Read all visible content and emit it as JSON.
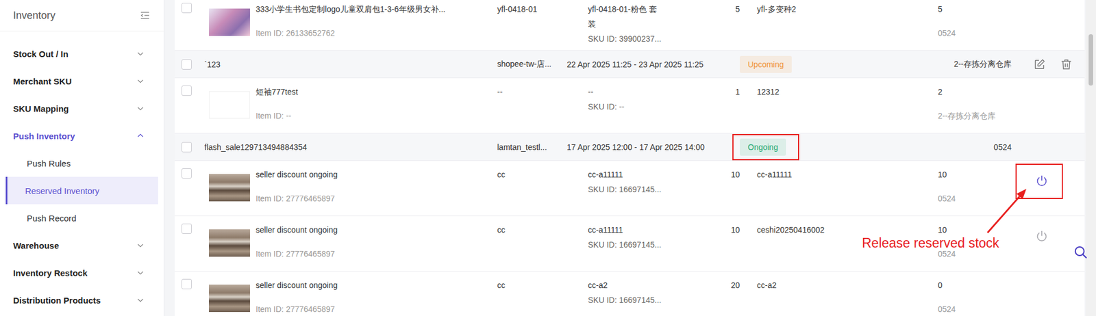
{
  "sidebar": {
    "title": "Inventory",
    "menu": [
      {
        "label": "Stock Out / In",
        "expanded": false,
        "selected": false,
        "children": []
      },
      {
        "label": "Merchant SKU",
        "expanded": false,
        "selected": false,
        "children": []
      },
      {
        "label": "SKU Mapping",
        "expanded": false,
        "selected": false,
        "children": []
      },
      {
        "label": "Push Inventory",
        "expanded": true,
        "selected": true,
        "children": [
          {
            "label": "Push Rules",
            "selected": false
          },
          {
            "label": "Reserved Inventory",
            "selected": true
          },
          {
            "label": "Push Record",
            "selected": false
          }
        ]
      },
      {
        "label": "Warehouse",
        "expanded": false,
        "selected": false,
        "children": []
      },
      {
        "label": "Inventory Restock",
        "expanded": false,
        "selected": false,
        "children": []
      },
      {
        "label": "Distribution Products",
        "expanded": false,
        "selected": false,
        "children": []
      }
    ]
  },
  "table": {
    "rows": [
      {
        "kind": "product",
        "checked": false,
        "thumb": "backpack",
        "name": "333小学生书包定制logo儿童双肩包1-3-6年级男女补...",
        "item_id": "Item ID: 26133652762",
        "variation": "yfl-0418-01",
        "sku": "yfl-0418-01-粉色 套装",
        "sku_id": "SKU ID: 39900237...",
        "qty": "5",
        "merchant_sku": "yfl-多变种2",
        "stock": "5",
        "warehouse": "0524",
        "has_release": false,
        "release_enabled": false,
        "marked": false
      },
      {
        "kind": "campaign",
        "checked": false,
        "name": "`123",
        "store": "shopee-tw-店...",
        "period": "22 Apr 2025 11:25 - 23 Apr 2025 11:25",
        "status": "Upcoming",
        "color": "#f0963c",
        "warehouse": "2--存拣分离仓库",
        "editable": true,
        "marked": false
      },
      {
        "kind": "product",
        "checked": false,
        "thumb": "blank",
        "name": "短袖777test",
        "item_id": "Item ID: --",
        "variation": "--",
        "sku": "--",
        "sku_id": "SKU ID: --",
        "qty": "1",
        "merchant_sku": "12312",
        "stock": "2",
        "warehouse": "2--存拣分离仓库",
        "has_release": false,
        "release_enabled": false,
        "marked": false
      },
      {
        "kind": "campaign",
        "checked": false,
        "name": "flash_sale129713494884354",
        "store": "lamtan_testl...",
        "period": "17 Apr 2025 12:00 - 17 Apr 2025 14:00",
        "status": "Ongoing",
        "color": "#23a977",
        "warehouse": "0524",
        "editable": false,
        "marked": true
      },
      {
        "kind": "product",
        "checked": false,
        "thumb": "photo",
        "name": "seller discount ongoing",
        "item_id": "Item ID: 27776465897",
        "variation": "cc",
        "sku": "cc-a11111",
        "sku_id": "SKU ID: 16697145...",
        "qty": "10",
        "merchant_sku": "cc-a11111",
        "stock": "10",
        "warehouse": "0524",
        "has_release": true,
        "release_enabled": true,
        "marked": true
      },
      {
        "kind": "product",
        "checked": false,
        "thumb": "photo",
        "name": "seller discount ongoing",
        "item_id": "Item ID: 27776465897",
        "variation": "cc",
        "sku": "cc-a11111",
        "sku_id": "SKU ID: 16697145...",
        "qty": "10",
        "merchant_sku": "ceshi20250416002",
        "stock": "10",
        "warehouse": "0524",
        "has_release": true,
        "release_enabled": false,
        "marked": false
      },
      {
        "kind": "product",
        "checked": false,
        "thumb": "photo",
        "name": "seller discount ongoing",
        "item_id": "Item ID: 27776465897",
        "variation": "cc",
        "sku": "cc-a2",
        "sku_id": "SKU ID: 16697145...",
        "qty": "20",
        "merchant_sku": "cc-a2",
        "stock": "0",
        "warehouse": "0524",
        "has_release": false,
        "release_enabled": false,
        "marked": false
      }
    ]
  },
  "annotation": {
    "label": "Release reserved stock",
    "color": "#e8201f"
  }
}
